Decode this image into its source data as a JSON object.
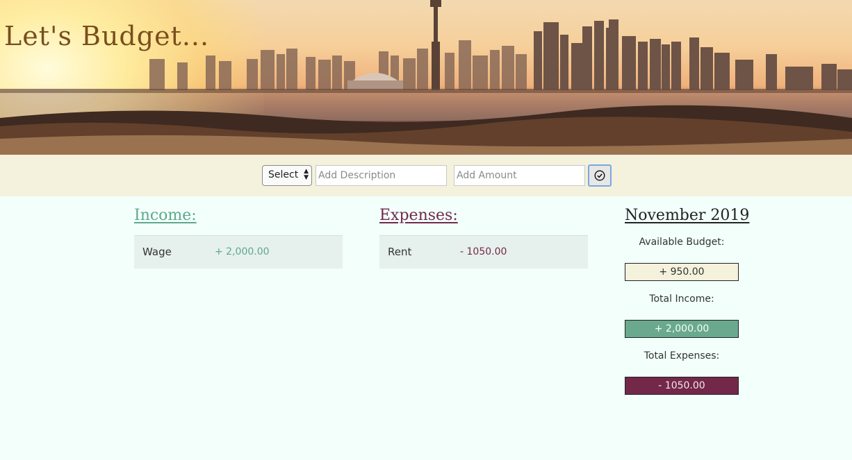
{
  "app": {
    "title": "Let's Budget..."
  },
  "form": {
    "type_select_value": "Select",
    "description_placeholder": "Add Description",
    "amount_placeholder": "Add Amount",
    "submit_icon": "check-circle-icon"
  },
  "income": {
    "title": "Income:",
    "color": "#5fa88b",
    "items": [
      {
        "description": "Wage",
        "value": "+ 2,000.00"
      }
    ]
  },
  "expenses": {
    "title": "Expenses:",
    "color": "#73284a",
    "items": [
      {
        "description": "Rent",
        "value": "- 1050.00"
      }
    ]
  },
  "summary": {
    "month": "November 2019",
    "available_label": "Available Budget:",
    "available_value": "+ 950.00",
    "total_income_label": "Total Income:",
    "total_income_value": "+ 2,000.00",
    "total_expenses_label": "Total Expenses:",
    "total_expenses_value": "- 1050.00"
  },
  "colors": {
    "page_background": "#f2fffb",
    "form_bar": "#f4f1dc",
    "income_accent": "#6aa98e",
    "expense_accent": "#73284a",
    "title_brown": "#7a4e1e"
  }
}
